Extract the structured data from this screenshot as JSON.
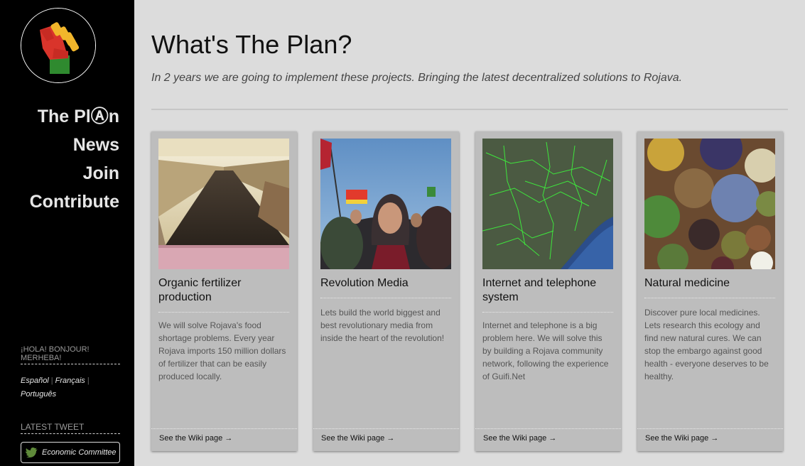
{
  "sidebar": {
    "nav": [
      {
        "label": "The PlⒶn"
      },
      {
        "label": "News"
      },
      {
        "label": "Join"
      },
      {
        "label": "Contribute"
      }
    ],
    "greeting": "¡HOLA! BONJOUR! MERHEBA!",
    "languages": [
      "Español",
      "Français",
      "Português"
    ],
    "latest_tweet_label": "LATEST TWEET",
    "tweet_button": "Economic Committee"
  },
  "main": {
    "title": "What's The Plan?",
    "subtitle": "In 2 years we are going to implement these projects. Bringing the latest decentralized solutions to Rojava.",
    "cards": [
      {
        "title": "Organic fertilizer production",
        "description": "We will solve Rojava's food shortage problems. Every year Rojava imports 150 million dollars of fertilizer that can be easily produced locally.",
        "link": "See the Wiki page →"
      },
      {
        "title": "Revolution Media",
        "description": "Lets build the world biggest and best revolutionary media from inside the heart of the revolution!",
        "link": "See the Wiki page →"
      },
      {
        "title": "Internet and telephone system",
        "description": "Internet and telephone is a big problem here. We will solve this by building a Rojava community network, following the experience of Guifi.Net",
        "link": "See the Wiki page →"
      },
      {
        "title": "Natural medicine",
        "description": "Discover pure local medicines. Lets research this ecology and find new natural cures. We can stop the embargo against good health - everyone deserves to be healthy.",
        "link": "See the Wiki page →"
      }
    ]
  },
  "colors": {
    "sidebar_bg": "#000000",
    "page_bg": "#dcdcdc",
    "card_bg": "#bdbdbd",
    "logo_red": "#d9342b",
    "logo_yellow": "#f2b62b",
    "logo_green": "#2f8a2f"
  }
}
